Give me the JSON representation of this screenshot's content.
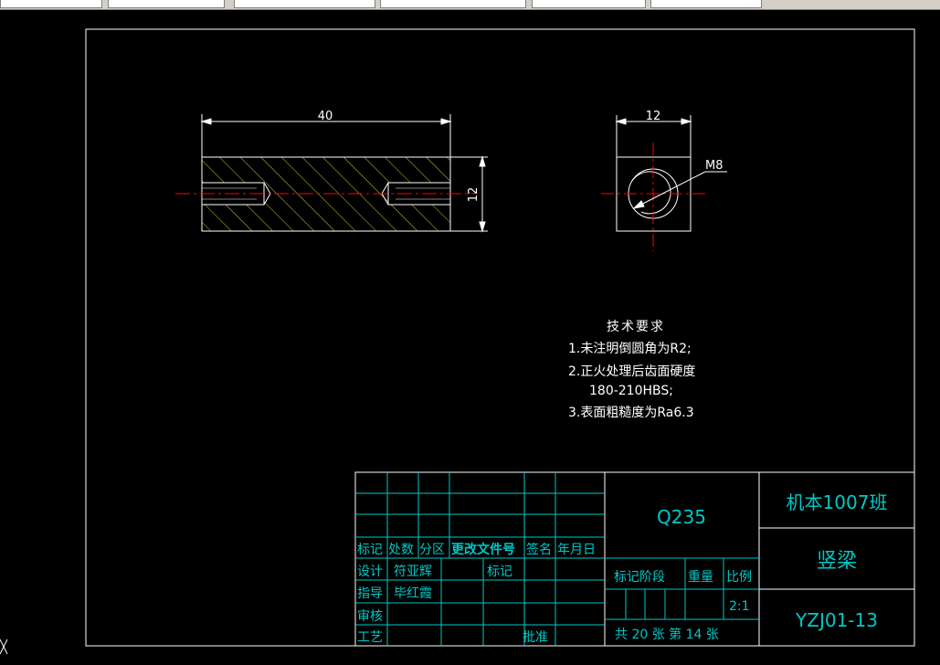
{
  "drawing": {
    "front_view": {
      "length_dim": "40",
      "height_dim": "12"
    },
    "side_view": {
      "width_dim": "12",
      "thread_label": "M8"
    }
  },
  "tech_req": {
    "title": "技术要求",
    "lines": [
      "1.未注明倒圆角为R2;",
      "2.正火处理后齿面硬度",
      "180-210HBS;",
      "3.表面粗糙度为Ra6.3"
    ]
  },
  "title_block": {
    "material": "Q235",
    "class_name": "机本1007班",
    "part_name": "竖梁",
    "drawing_no": "YZJ01-13",
    "headers": [
      "标记",
      "处数",
      "分区",
      "更改文件号",
      "签名",
      "年月日"
    ],
    "design_label": "设计",
    "designer": "符亚辉",
    "mark_label": "标记",
    "guide_label": "指导",
    "guide": "毕红霞",
    "review_label": "审核",
    "process_label": "工艺",
    "approve_label": "批准",
    "stage_label": "标记阶段",
    "weight_label": "重量",
    "scale_label": "比例",
    "scale_value": "2:1",
    "sheets": "共 20 张 第 14 张"
  },
  "colors": {
    "outline": "#ffffff",
    "hatch": "#c8c832",
    "center": "#ff0000",
    "title_block": "#00c8c8"
  }
}
